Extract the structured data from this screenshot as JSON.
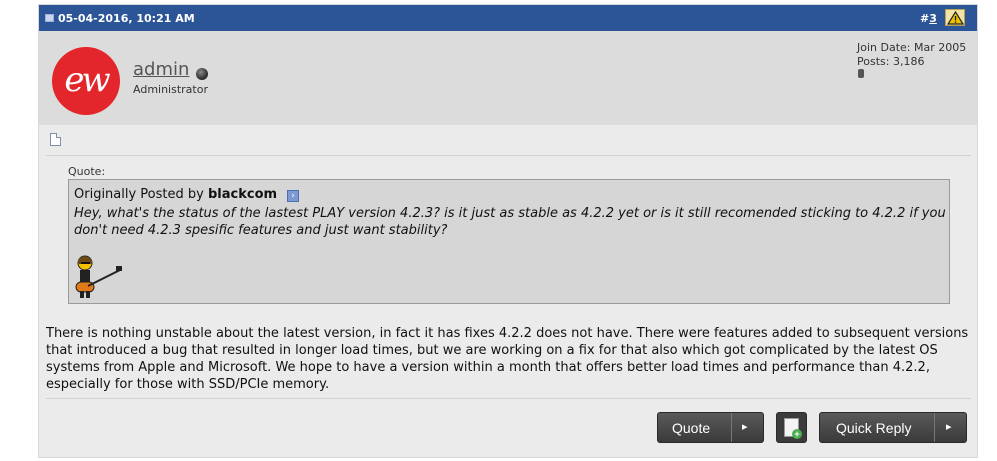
{
  "header": {
    "date": "05-04-2016, 10:21 AM",
    "post_number_prefix": "#",
    "post_number": "3",
    "report_icon": "warning-icon"
  },
  "user": {
    "avatar_text": "ew",
    "avatar_color": "#e3262b",
    "name": "admin",
    "title": "Administrator",
    "join_date": "Join Date: Mar 2005",
    "posts": "Posts: 3,186"
  },
  "quote": {
    "label": "Quote:",
    "originally_posted_by": "Originally Posted by",
    "author": "blackcom",
    "text": "Hey, what's the status of the lastest PLAY version 4.2.3? is it just as stable as 4.2.2 yet or is it still recomended sticking to 4.2.2 if you don't need 4.2.3 spesific features and just want stability?"
  },
  "message": "There is nothing unstable about the latest version, in fact it has fixes 4.2.2 does not have. There were features added to subsequent versions that introduced a bug that resulted in longer load times, but we are working on a fix for that also which got complicated by the latest OS systems from Apple and Microsoft. We hope to have a version within a month that offers better load times and performance than 4.2.2, especially for those with SSD/PCIe memory.",
  "buttons": {
    "quote": "Quote",
    "quick_reply": "Quick Reply",
    "arrow": "▸"
  },
  "colors": {
    "header_bg": "#2b5597",
    "post_bg": "#ebebeb",
    "userinfo_bg": "#dcdcdc",
    "quote_bg": "#d6d6d6",
    "button_bg": "#444444"
  }
}
